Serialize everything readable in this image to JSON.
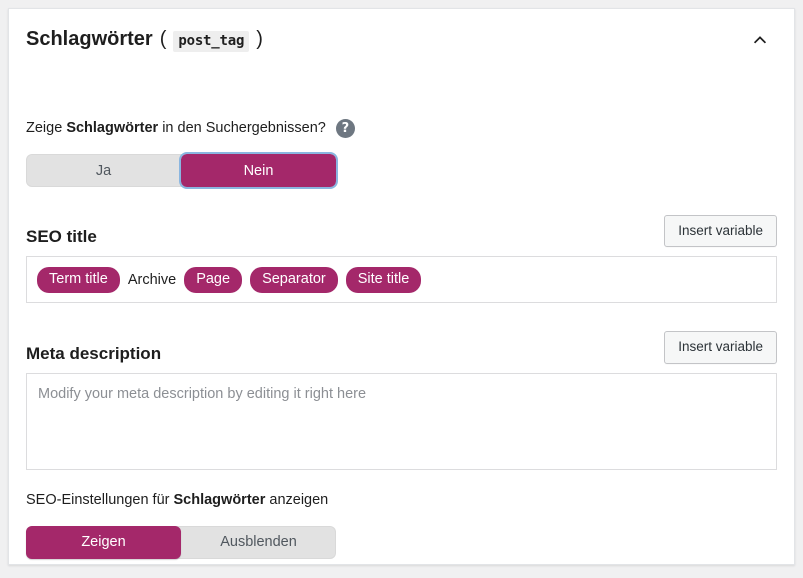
{
  "panel": {
    "title": "Schlagwörter",
    "paren_open": "(",
    "post_type_code": "post_tag",
    "paren_close": ")",
    "collapse_icon": "chevron-up-icon"
  },
  "search_appearance": {
    "question_prefix": "Zeige ",
    "question_bold": "Schlagwörter",
    "question_suffix": " in den Suchergebnissen?",
    "help_icon_label": "?",
    "toggle": {
      "options": [
        "Ja",
        "Nein"
      ],
      "selected": "Nein",
      "focused": "Nein"
    }
  },
  "seo_title": {
    "label": "SEO title",
    "insert_variable_label": "Insert variable",
    "tokens": [
      {
        "text": "Term title",
        "type": "variable"
      },
      {
        "text": "Archive",
        "type": "text"
      },
      {
        "text": "Page",
        "type": "variable"
      },
      {
        "text": "Separator",
        "type": "variable"
      },
      {
        "text": "Site title",
        "type": "variable"
      }
    ]
  },
  "meta_description": {
    "label": "Meta description",
    "insert_variable_label": "Insert variable",
    "value": "",
    "placeholder": "Modify your meta description by editing it right here"
  },
  "seo_settings_visibility": {
    "label_prefix": "SEO-Einstellungen für ",
    "label_bold": "Schlagwörter",
    "label_suffix": " anzeigen",
    "toggle": {
      "options": [
        "Zeigen",
        "Ausblenden"
      ],
      "selected": "Zeigen"
    }
  },
  "colors": {
    "accent": "#a4286a",
    "toggle_track": "#e2e2e2",
    "focus_ring": "#8ab6e0",
    "page_background": "#f0f0f1",
    "card_border": "#e2e4e7"
  }
}
